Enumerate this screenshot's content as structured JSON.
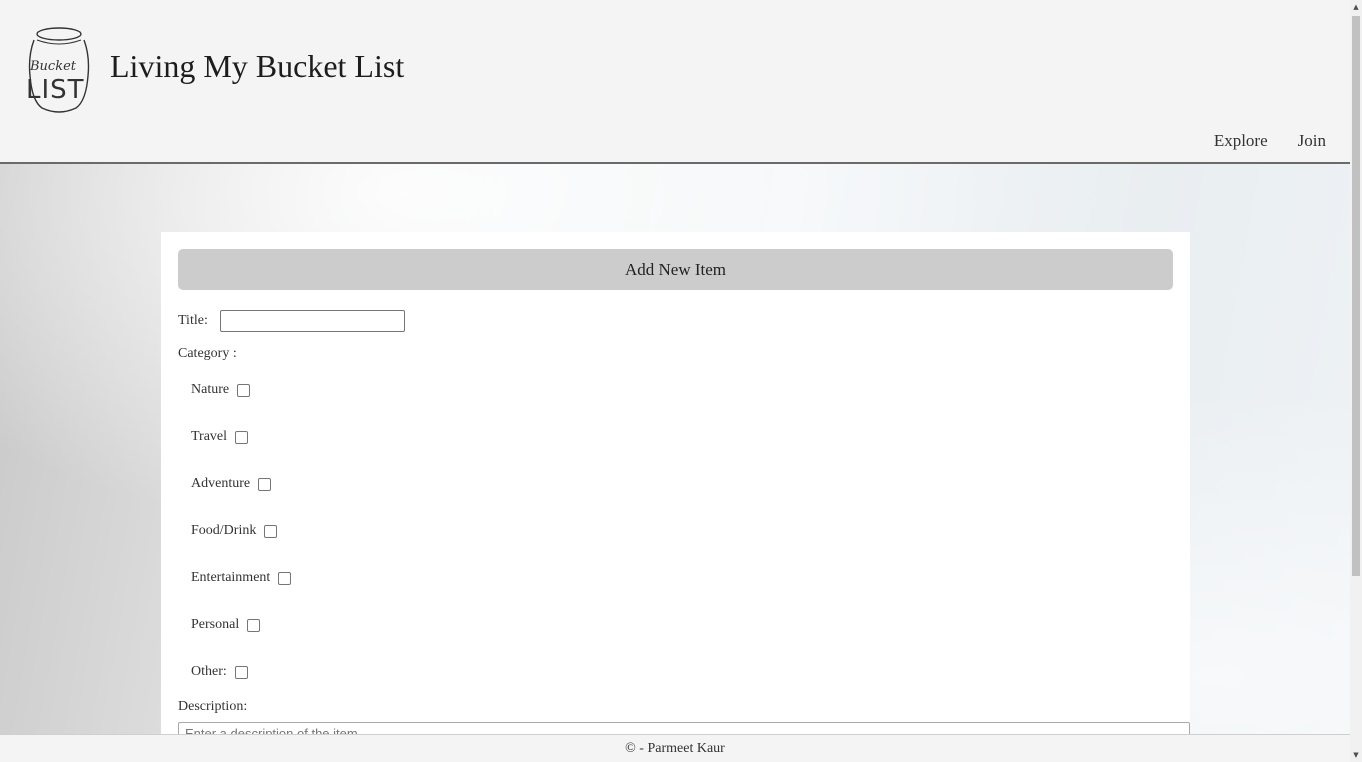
{
  "header": {
    "site_title": "Living My Bucket List",
    "logo": {
      "text_top": "Bucket",
      "text_bottom": "LIST"
    },
    "nav": [
      {
        "label": "Explore"
      },
      {
        "label": "Join"
      }
    ]
  },
  "form": {
    "heading": "Add New Item",
    "title_label": "Title:",
    "title_value": "",
    "category_label": "Category :",
    "categories": [
      {
        "label": "Nature",
        "checked": false
      },
      {
        "label": "Travel",
        "checked": false
      },
      {
        "label": "Adventure",
        "checked": false
      },
      {
        "label": "Food/Drink",
        "checked": false
      },
      {
        "label": "Entertainment",
        "checked": false
      },
      {
        "label": "Personal",
        "checked": false
      },
      {
        "label": "Other:",
        "checked": false
      }
    ],
    "description_label": "Description:",
    "description_placeholder": "Enter a description of the item"
  },
  "footer": {
    "text": "© - Parmeet Kaur"
  },
  "colors": {
    "header_bg": "#f4f4f4",
    "heading_bar": "#cccccc",
    "card_bg": "#ffffff"
  }
}
